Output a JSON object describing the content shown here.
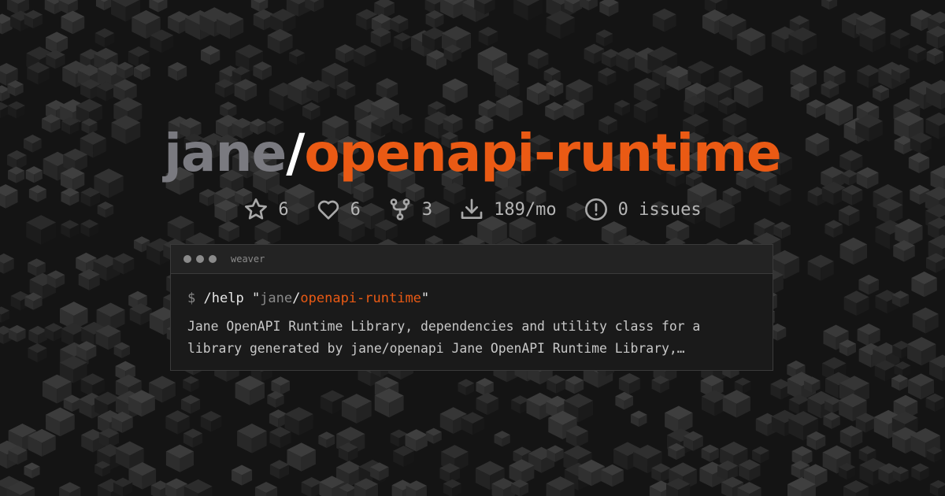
{
  "header": {
    "owner": "jane",
    "separator": "/",
    "repo": "openapi-runtime"
  },
  "stats": [
    {
      "icon": "star-icon",
      "value": "6"
    },
    {
      "icon": "heart-icon",
      "value": "6"
    },
    {
      "icon": "fork-icon",
      "value": "3"
    },
    {
      "icon": "download-icon",
      "value": "189/mo"
    },
    {
      "icon": "issue-icon",
      "value": "0 issues"
    }
  ],
  "terminal": {
    "title": "weaver",
    "prompt": "$",
    "command": "/help",
    "quote_open": "\"",
    "arg_owner": "jane",
    "arg_separator": "/",
    "arg_repo": "openapi-runtime",
    "quote_close": "\"",
    "description": "Jane OpenAPI Runtime Library, dependencies and utility class for a library generated by jane/openapi Jane OpenAPI Runtime Library,…"
  },
  "colors": {
    "accent": "#ea5a14",
    "background": "#141414",
    "owner": "#7a7a80"
  }
}
